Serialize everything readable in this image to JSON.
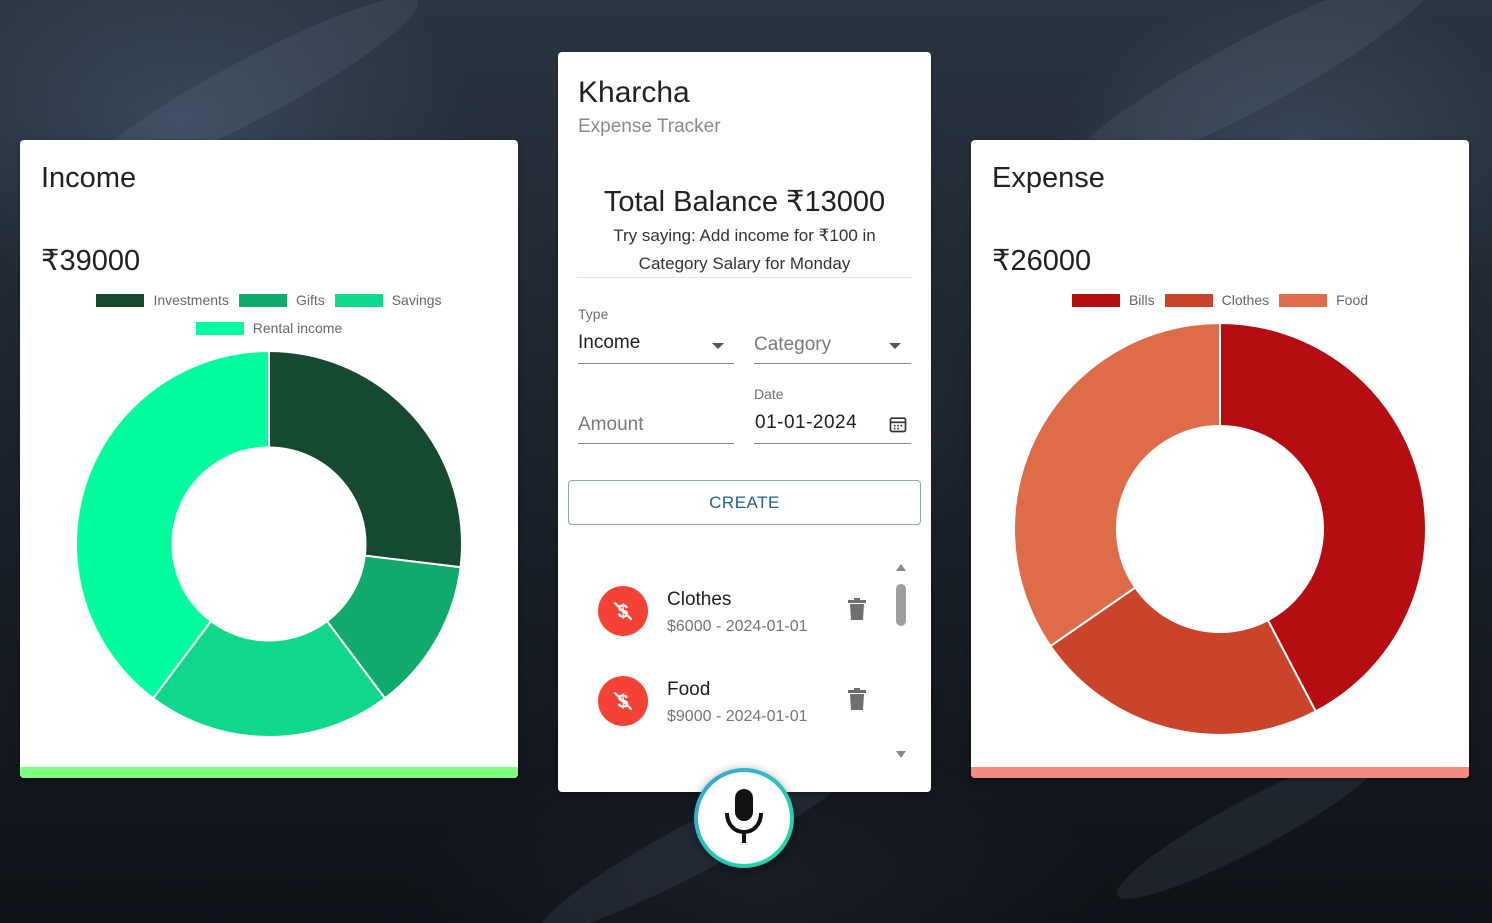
{
  "income": {
    "title": "Income",
    "amount": "₹39000",
    "bar_color": "#80ff80"
  },
  "expense": {
    "title": "Expense",
    "amount": "₹26000",
    "bar_color": "#f48a80"
  },
  "main": {
    "app_name": "Kharcha",
    "app_subtitle": "Expense Tracker",
    "balance": "Total Balance ₹13000",
    "hint": "Try saying: Add income for ₹100 in Category Salary for Monday",
    "form": {
      "type_label": "Type",
      "type_value": "Income",
      "category_placeholder": "Category",
      "amount_placeholder": "Amount",
      "date_label": "Date",
      "date_value": "01-01-2024",
      "create_label": "CREATE"
    },
    "transactions": [
      {
        "name": "Clothes",
        "detail": "$6000 - 2024-01-01"
      },
      {
        "name": "Food",
        "detail": "$9000 - 2024-01-01"
      }
    ]
  },
  "icons": {
    "transaction": "money-off-icon",
    "delete": "trash-icon",
    "date": "calendar-icon",
    "mic": "microphone-icon"
  },
  "chart_data": [
    {
      "type": "pie",
      "variant": "doughnut",
      "categories": [
        "Investments",
        "Gifts",
        "Savings",
        "Rental income"
      ],
      "values": [
        10500,
        5000,
        8000,
        15500
      ],
      "colors": [
        "#164a30",
        "#10ab6c",
        "#10d88a",
        "#00fd9e"
      ],
      "legend": "top"
    },
    {
      "type": "pie",
      "variant": "doughnut",
      "categories": [
        "Bills",
        "Clothes",
        "Food"
      ],
      "values": [
        11000,
        6000,
        9000
      ],
      "colors": [
        "#b50d12",
        "#ca442c",
        "#de6c49"
      ],
      "legend": "top"
    }
  ]
}
